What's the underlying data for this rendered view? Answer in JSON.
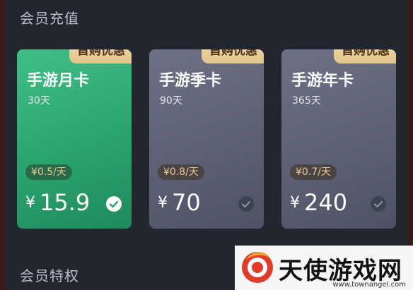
{
  "sections": {
    "recharge_title": "会员充值",
    "privileges_title": "会员特权"
  },
  "plans": [
    {
      "badge": "首购优惠",
      "name": "手游月卡",
      "days": "30天",
      "per_day": "¥0.5/天",
      "currency": "¥",
      "price": "15.9",
      "selected": true
    },
    {
      "badge": "首购优惠",
      "name": "手游季卡",
      "days": "90天",
      "per_day": "¥0.8/天",
      "currency": "¥",
      "price": "70",
      "selected": false
    },
    {
      "badge": "首购优惠",
      "name": "手游年卡",
      "days": "365天",
      "per_day": "¥0.7/天",
      "currency": "¥",
      "price": "240",
      "selected": false
    }
  ],
  "watermark": {
    "text": "天使游戏网",
    "url": "www.townangel.com"
  },
  "colors": {
    "selected_card": "#2fae77",
    "normal_card": "#62657a",
    "badge": "#ebcf9b",
    "per_day_text": "#e8c98f",
    "background": "#22262f"
  },
  "icons": {
    "check": "check-circle-icon"
  }
}
